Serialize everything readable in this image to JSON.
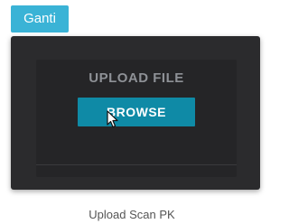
{
  "replace_button": {
    "label": "Ganti",
    "color": "#3ab3d6"
  },
  "upload_panel": {
    "title": "UPLOAD FILE",
    "browse_label": "BROWSE",
    "browse_color": "#0f8aa6",
    "background": "#2b2b2d"
  },
  "cursor": {
    "icon": "mouse-pointer-icon"
  },
  "caption": "Upload Scan PK"
}
